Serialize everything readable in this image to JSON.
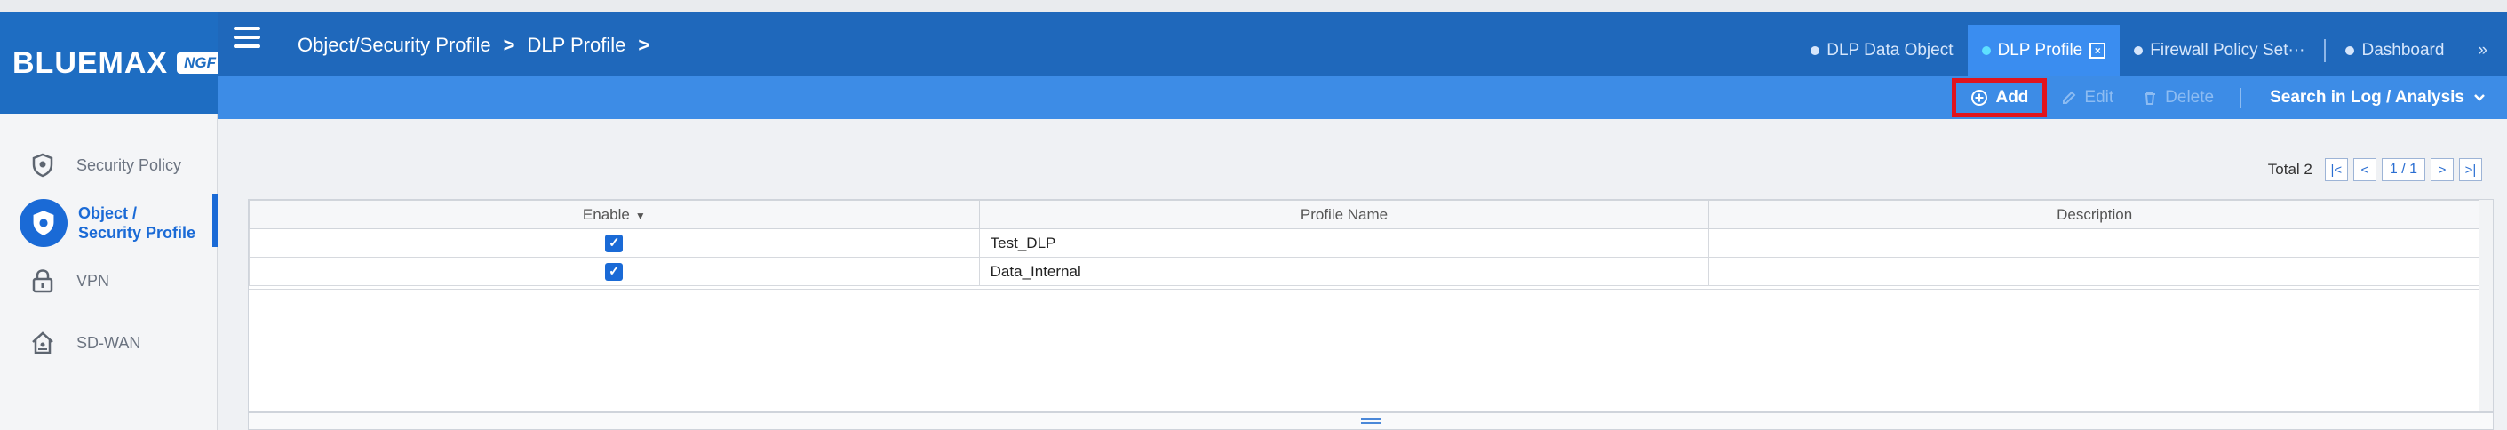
{
  "brand": {
    "logo": "BLUEMAX",
    "suffix": "NGF"
  },
  "sidebar": {
    "items": [
      {
        "label": "Security Policy",
        "icon": "shield-icon",
        "active": false
      },
      {
        "label": "Object /\nSecurity Profile",
        "icon": "shield-check-icon",
        "active": true
      },
      {
        "label": "VPN",
        "icon": "lock-icon",
        "active": false
      },
      {
        "label": "SD-WAN",
        "icon": "home-network-icon",
        "active": false
      }
    ]
  },
  "breadcrumb": {
    "part1": "Object/Security Profile",
    "sep1": ">",
    "part2": "DLP Profile",
    "sep2": ">"
  },
  "tabs": [
    {
      "label": "DLP Data Object",
      "active": false
    },
    {
      "label": "DLP Profile",
      "active": true
    },
    {
      "label": "Firewall Policy Set···",
      "active": false
    },
    {
      "label": "Dashboard",
      "active": false
    }
  ],
  "tabs_more": "»",
  "toolbar": {
    "add": "Add",
    "edit": "Edit",
    "delete": "Delete",
    "search": "Search in Log / Analysis"
  },
  "pager": {
    "total_label": "Total 2",
    "page": "1 / 1"
  },
  "table": {
    "headers": [
      "Enable",
      "Profile Name",
      "Description"
    ],
    "rows": [
      {
        "enabled": true,
        "name": "Test_DLP",
        "description": ""
      },
      {
        "enabled": true,
        "name": "Data_Internal",
        "description": ""
      }
    ]
  },
  "colors": {
    "topbar": "#1f68bb",
    "toolbar": "#3d8ce6",
    "accent": "#1a6ad6",
    "highlight": "#e1141d"
  }
}
